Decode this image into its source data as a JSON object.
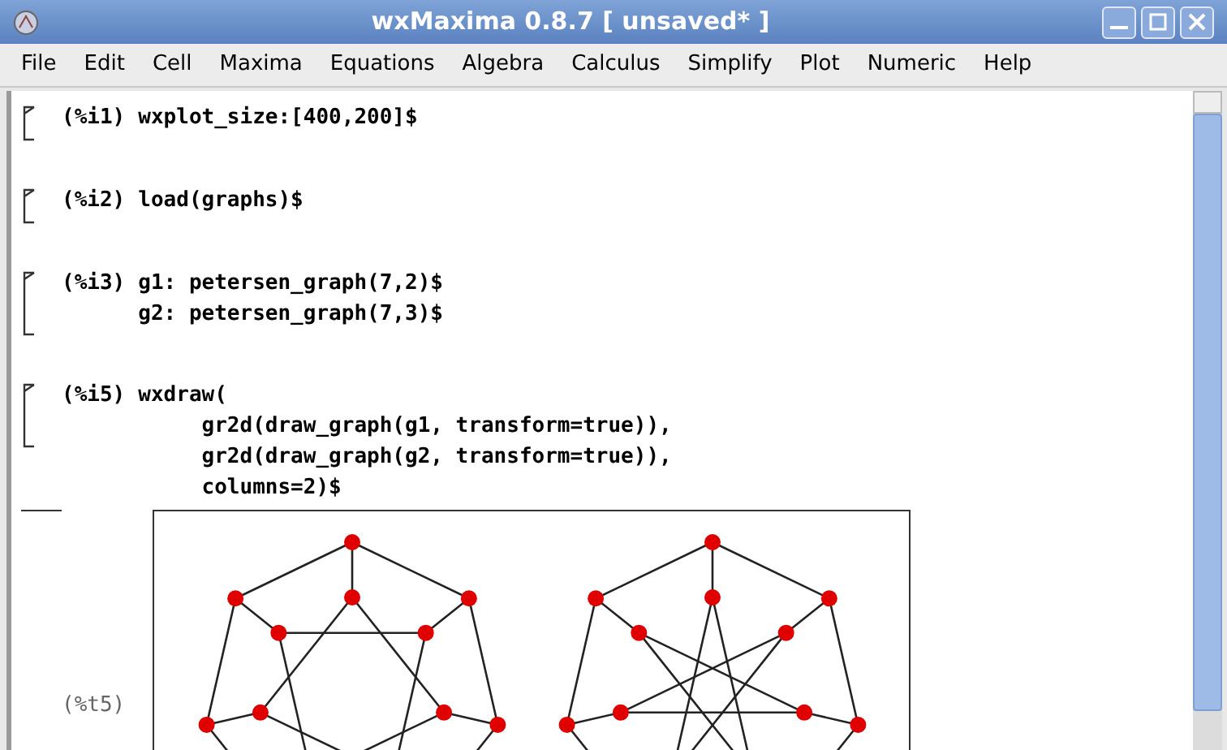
{
  "window": {
    "title": "wxMaxima 0.8.7 [ unsaved* ]"
  },
  "menu": [
    "File",
    "Edit",
    "Cell",
    "Maxima",
    "Equations",
    "Algebra",
    "Calculus",
    "Simplify",
    "Plot",
    "Numeric",
    "Help"
  ],
  "cells": [
    {
      "label": "(%i1)",
      "lines": [
        "wxplot_size:[400,200]$"
      ]
    },
    {
      "label": "(%i2)",
      "lines": [
        "load(graphs)$"
      ]
    },
    {
      "label": "(%i3)",
      "lines": [
        "g1: petersen_graph(7,2)$",
        "g2: petersen_graph(7,3)$"
      ]
    },
    {
      "label": "(%i5)",
      "lines": [
        "wxdraw(",
        "     gr2d(draw_graph(g1, transform=true)),",
        "     gr2d(draw_graph(g2, transform=true)),",
        "     columns=2)$"
      ]
    }
  ],
  "output": {
    "label": "(%t5)"
  }
}
